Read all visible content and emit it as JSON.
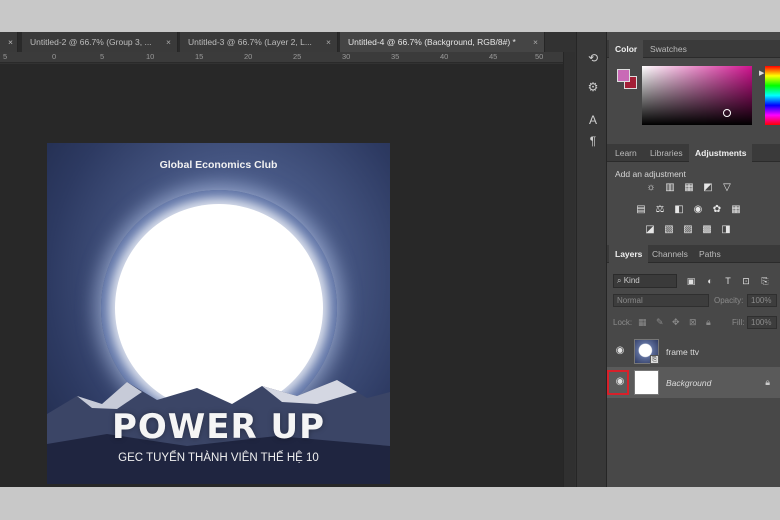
{
  "document_tabs": [
    {
      "label": "Untitled-2 @ 66.7% (Group 3, ...",
      "active": false
    },
    {
      "label": "Untitled-3 @ 66.7% (Layer 2, L...",
      "active": false
    },
    {
      "label": "Untitled-4 @ 66.7% (Background, RGB/8#) *",
      "active": true
    }
  ],
  "ruler": {
    "marks": [
      "5",
      "0",
      "5",
      "10",
      "15",
      "20",
      "25",
      "30",
      "35",
      "40",
      "45",
      "50"
    ]
  },
  "artwork": {
    "club_name": "Global Economics Club",
    "headline": "POWER UP",
    "subtitle": "GEC TUYỂN THÀNH VIÊN THẾ HỆ 10"
  },
  "color_panel": {
    "tabs": [
      "Color",
      "Swatches"
    ],
    "foreground": "#c96ab6",
    "background": "#a31f36"
  },
  "adjustments_panel": {
    "tabs": [
      "Learn",
      "Libraries",
      "Adjustments"
    ],
    "add_label": "Add an adjustment"
  },
  "layers_panel": {
    "tabs": [
      "Layers",
      "Channels",
      "Paths"
    ],
    "filter_kind": "Kind",
    "blend_mode": "Normal",
    "opacity_label": "Opacity:",
    "opacity_value": "100%",
    "lock_label": "Lock:",
    "fill_label": "Fill:",
    "fill_value": "100%",
    "layers": [
      {
        "name": "frame ttv",
        "visible": true
      },
      {
        "name": "Background",
        "visible": true,
        "locked": true
      }
    ]
  },
  "colors": {
    "highlight": "#d8202a"
  }
}
